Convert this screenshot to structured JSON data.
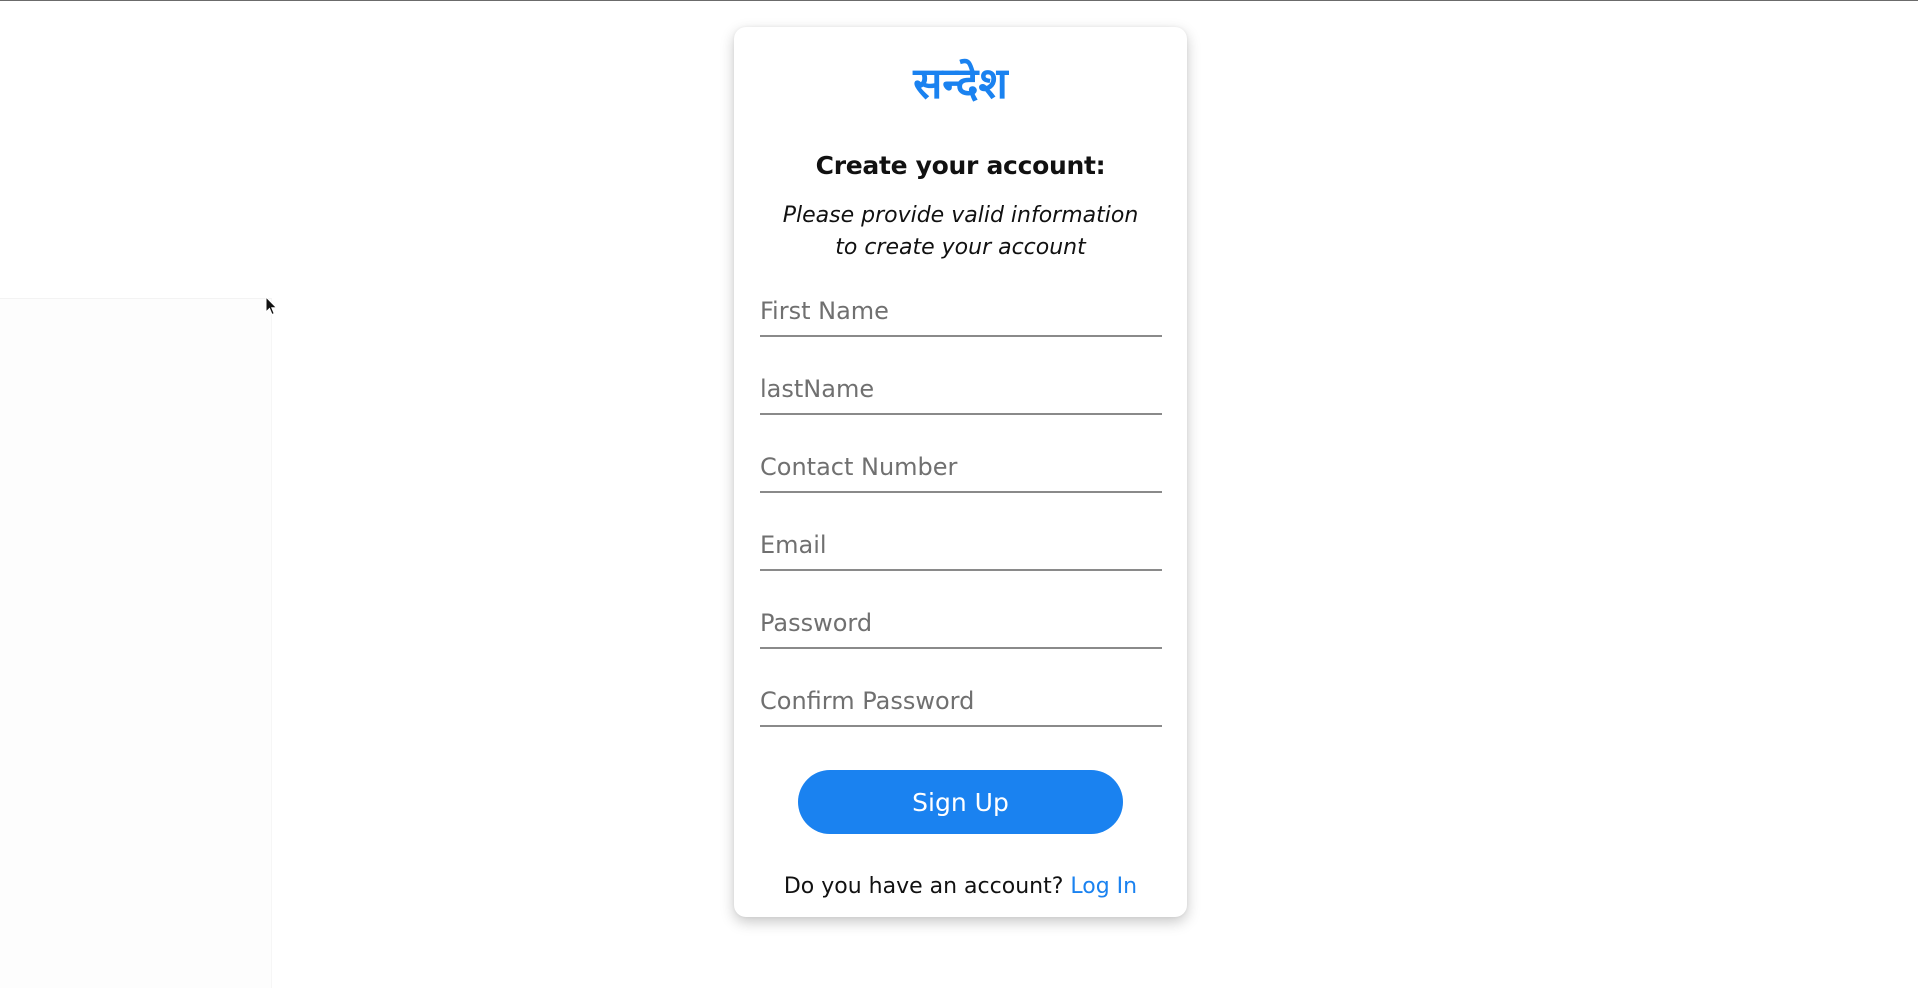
{
  "app": {
    "logo_text": "सन्देश",
    "brand_color": "#1a82f0"
  },
  "form": {
    "heading": "Create your account:",
    "subtitle_line1": "Please provide valid information",
    "subtitle_line2": "to create your account",
    "fields": [
      {
        "placeholder": "First Name",
        "value": ""
      },
      {
        "placeholder": "lastName",
        "value": ""
      },
      {
        "placeholder": "Contact Number",
        "value": ""
      },
      {
        "placeholder": "Email",
        "value": ""
      },
      {
        "placeholder": "Password",
        "value": ""
      },
      {
        "placeholder": "Confirm Password",
        "value": ""
      }
    ],
    "submit_label": "Sign Up",
    "login_prompt": "Do you have an account?",
    "login_link": "Log In"
  },
  "icons": {
    "cursor": "mouse-pointer-icon"
  }
}
